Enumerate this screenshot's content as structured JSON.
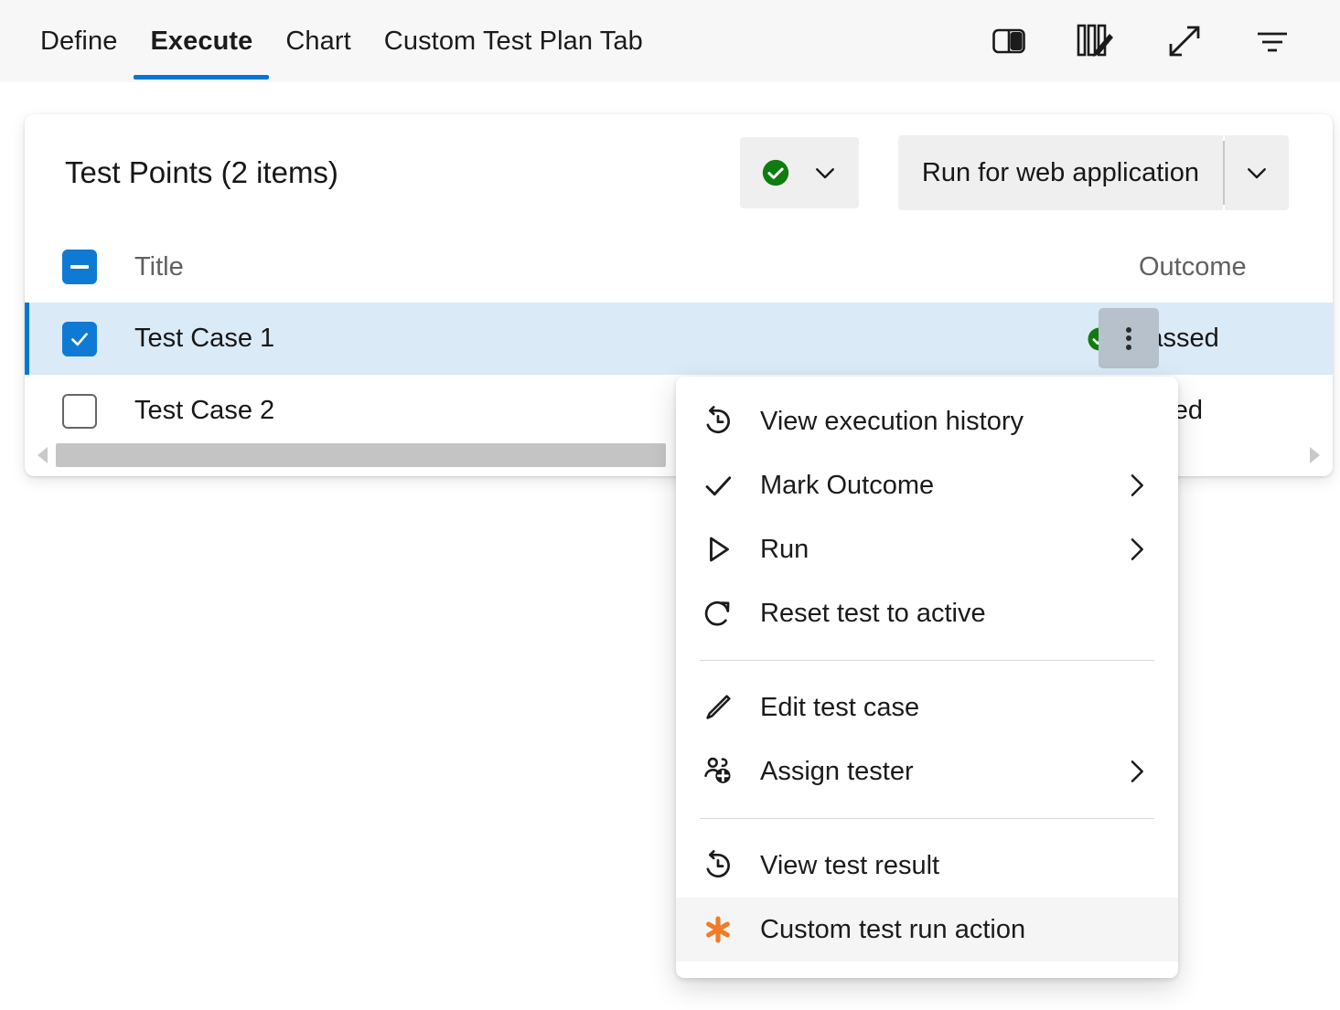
{
  "tabbar": {
    "tabs": [
      {
        "label": "Define",
        "active": false
      },
      {
        "label": "Execute",
        "active": true
      },
      {
        "label": "Chart",
        "active": false
      },
      {
        "label": "Custom Test Plan Tab",
        "active": false
      }
    ],
    "tools": [
      {
        "name": "split-pane-icon",
        "title": "Pane layout"
      },
      {
        "name": "column-options-icon",
        "title": "Column options"
      },
      {
        "name": "fullscreen-expand-icon",
        "title": "Full screen"
      },
      {
        "name": "filter-icon",
        "title": "Filter"
      }
    ]
  },
  "card": {
    "title": "Test Points (2 items)",
    "outcome_filter": {
      "icon": "passed-circle-icon",
      "caret": "chevron-down-icon"
    },
    "run_button": {
      "label": "Run for web application",
      "caret": "chevron-down-icon"
    }
  },
  "grid": {
    "columns": {
      "title": "Title",
      "outcome": "Outcome"
    },
    "header_checkbox_state": "indeterminate",
    "rows": [
      {
        "title": "Test Case 1",
        "outcome": "Passed",
        "outcome_icon": "passed-circle-icon",
        "checked": true,
        "selected": true
      },
      {
        "title": "Test Case 2",
        "outcome": "Failed",
        "outcome_icon": "failed-circle-icon",
        "checked": false,
        "selected": false
      }
    ],
    "scrollbar": {
      "left_arrow": "caret-left-icon",
      "right_arrow": "caret-right-icon"
    }
  },
  "context_menu": {
    "items": [
      {
        "label": "View execution history",
        "icon": "history-icon",
        "submenu": false,
        "hover": false
      },
      {
        "label": "Mark Outcome",
        "icon": "checkmark-icon",
        "submenu": true,
        "hover": false
      },
      {
        "label": "Run",
        "icon": "play-icon",
        "submenu": true,
        "hover": false
      },
      {
        "label": "Reset test to active",
        "icon": "refresh-icon",
        "submenu": false,
        "hover": false
      },
      {
        "separator": true
      },
      {
        "label": "Edit test case",
        "icon": "pencil-icon",
        "submenu": false,
        "hover": false
      },
      {
        "label": "Assign tester",
        "icon": "person-add-icon",
        "submenu": true,
        "hover": false
      },
      {
        "separator": true
      },
      {
        "label": "View test result",
        "icon": "history-icon",
        "submenu": false,
        "hover": false
      },
      {
        "label": "Custom test run action",
        "icon": "asterisk-icon",
        "submenu": false,
        "hover": true
      }
    ]
  },
  "colors": {
    "accent": "#0078d4",
    "passed": "#107c10",
    "failed": "#c4314b",
    "custom_action": "#f07b28",
    "row_selected_bg": "#dbeaf7",
    "header_bg": "#f7f7f7"
  }
}
